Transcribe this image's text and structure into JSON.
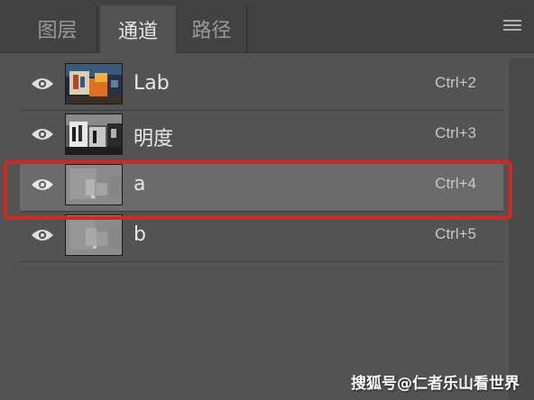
{
  "tabs": [
    {
      "label": "图层",
      "active": false
    },
    {
      "label": "通道",
      "active": true
    },
    {
      "label": "路径",
      "active": false
    }
  ],
  "menu_icon": "hamburger-menu-icon",
  "channels": [
    {
      "name": "Lab",
      "shortcut": "Ctrl+2",
      "visible": true,
      "selected": false,
      "thumbnail": "color"
    },
    {
      "name": "明度",
      "shortcut": "Ctrl+3",
      "visible": true,
      "selected": false,
      "thumbnail": "lightness"
    },
    {
      "name": "a",
      "shortcut": "Ctrl+4",
      "visible": true,
      "selected": true,
      "thumbnail": "gray"
    },
    {
      "name": "b",
      "shortcut": "Ctrl+5",
      "visible": true,
      "selected": false,
      "thumbnail": "gray"
    }
  ],
  "highlight_color": "#d4281e",
  "watermark": "搜狐号@仁者乐山看世界"
}
